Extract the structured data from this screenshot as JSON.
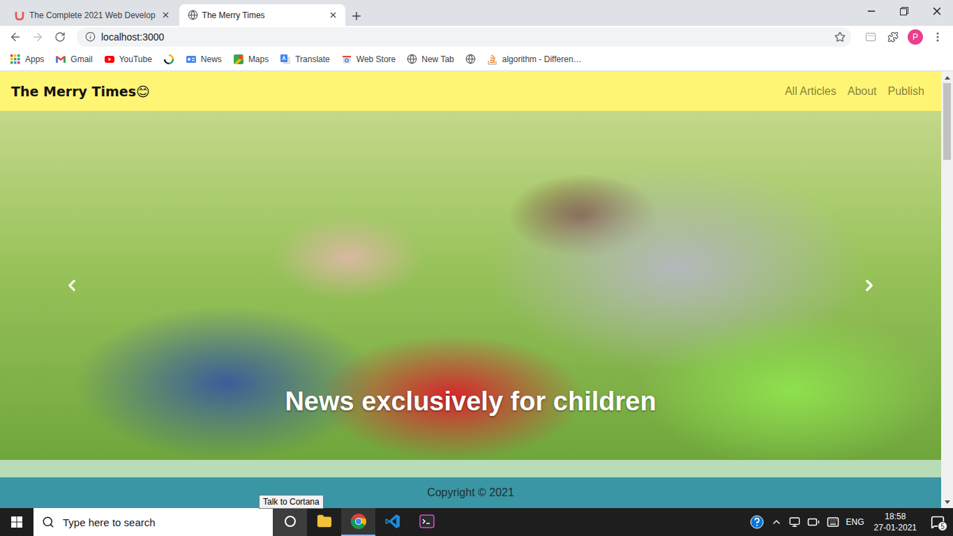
{
  "browser": {
    "tabs": [
      {
        "title": "The Complete 2021 Web Develop",
        "selected": false
      },
      {
        "title": "The Merry Times",
        "selected": true
      }
    ],
    "address": "localhost:3000",
    "profile": "P",
    "bookmarks": [
      {
        "label": "Apps",
        "kind": "link"
      },
      {
        "label": "Gmail",
        "kind": "link"
      },
      {
        "label": "YouTube",
        "kind": "link"
      },
      {
        "label": "",
        "kind": "icon"
      },
      {
        "label": "News",
        "kind": "link"
      },
      {
        "label": "Maps",
        "kind": "link"
      },
      {
        "label": "Translate",
        "kind": "link"
      },
      {
        "label": "Web Store",
        "kind": "link"
      },
      {
        "label": "New Tab",
        "kind": "link"
      },
      {
        "label": "",
        "kind": "icon"
      },
      {
        "label": "algorithm - Differen…",
        "kind": "link"
      }
    ]
  },
  "page": {
    "brand": "The Merry Times😊",
    "nav_links": [
      "All Articles",
      "About",
      "Publish"
    ],
    "carousel": {
      "caption": "News exclusively for children"
    },
    "footer": "Copyright © 2021"
  },
  "taskbar": {
    "search_placeholder": "Type here to search",
    "apps": [
      {
        "kind": "cortana",
        "selected": false,
        "hovered": true
      },
      {
        "kind": "explorer",
        "selected": false,
        "hovered": false
      },
      {
        "kind": "chrome",
        "selected": true,
        "hovered": false
      },
      {
        "kind": "vscode",
        "selected": false,
        "hovered": false
      },
      {
        "kind": "terminal",
        "selected": false,
        "hovered": false
      }
    ],
    "tray": {
      "language": "ENG",
      "time": "18:58",
      "date": "27-01-2021",
      "notifications": "5"
    }
  },
  "tooltip": "Talk to Cortana"
}
